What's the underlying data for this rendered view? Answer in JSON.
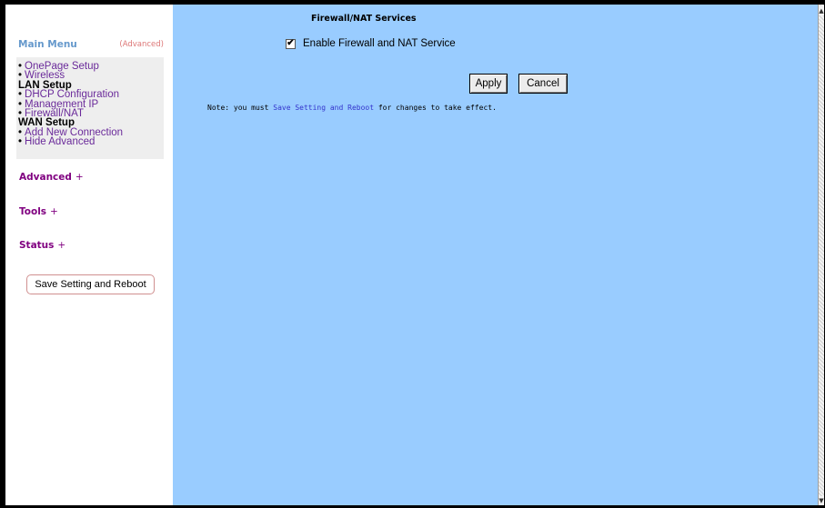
{
  "sidebar": {
    "main_menu_label": "Main Menu",
    "advanced_toggle_label": "(Advanced)",
    "menu_rows": [
      {
        "type": "item",
        "label": "OnePage Setup"
      },
      {
        "type": "item",
        "label": "Wireless"
      },
      {
        "type": "section",
        "label": "LAN Setup"
      },
      {
        "type": "item",
        "label": "DHCP Configuration"
      },
      {
        "type": "item",
        "label": "Management IP"
      },
      {
        "type": "item",
        "label": "Firewall/NAT"
      },
      {
        "type": "section",
        "label": "WAN Setup"
      },
      {
        "type": "item",
        "label": "Add New Connection"
      },
      {
        "type": "item",
        "label": "Hide Advanced"
      }
    ],
    "categories": {
      "advanced": "Advanced",
      "tools": "Tools",
      "status": "Status",
      "expand_symbol": "+"
    },
    "save_button_label": "Save Setting and Reboot"
  },
  "main": {
    "title": "Firewall/NAT Services",
    "checkbox": {
      "label": "Enable Firewall and NAT Service",
      "checked": true,
      "check_glyph": "✔"
    },
    "apply_label": "Apply",
    "cancel_label": "Cancel",
    "note": {
      "prefix": "Note: you must ",
      "link": "Save Setting and Reboot",
      "suffix": " for changes to take effect."
    }
  },
  "scrollbar": {
    "up_arrow": "▲",
    "down_arrow": "▼"
  },
  "colors": {
    "main_bg": "#99ccff",
    "menu_link": "#6a2a9a",
    "category": "#800080",
    "header": "#6699cc",
    "advanced_toggle": "#dd7777",
    "note_link": "#3333cc"
  }
}
